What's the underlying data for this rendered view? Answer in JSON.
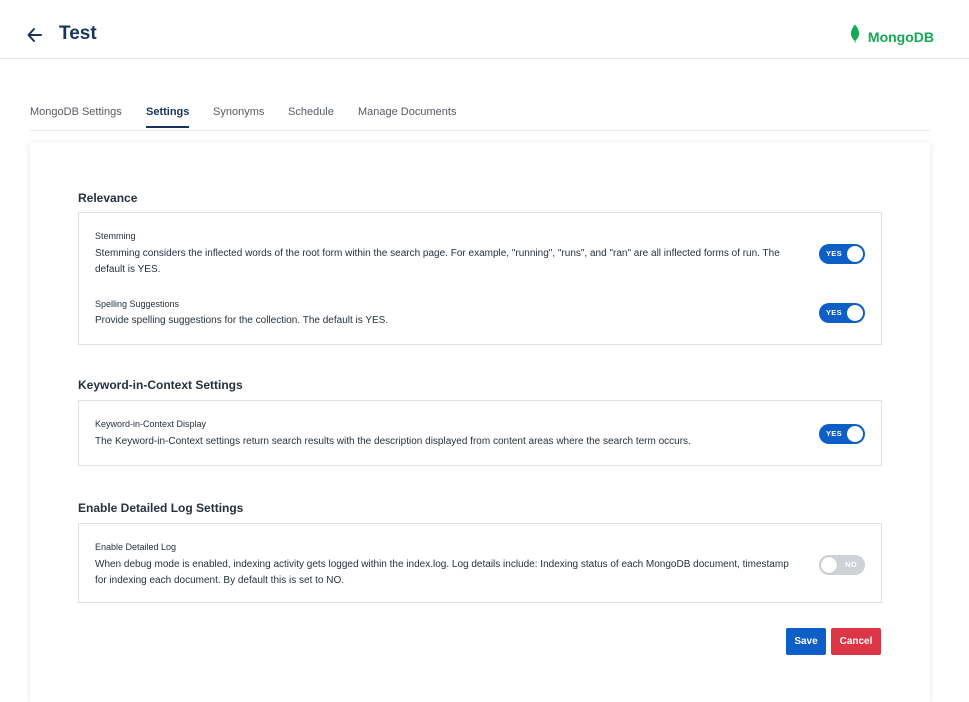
{
  "header": {
    "title": "Test",
    "brand_label": "MongoDB",
    "brand_color": "#13aa52"
  },
  "tabs": [
    {
      "label": "MongoDB Settings",
      "active": false
    },
    {
      "label": "Settings",
      "active": true
    },
    {
      "label": "Synonyms",
      "active": false
    },
    {
      "label": "Schedule",
      "active": false
    },
    {
      "label": "Manage Documents",
      "active": false
    }
  ],
  "sections": {
    "relevance": {
      "title": "Relevance",
      "settings": [
        {
          "name": "Stemming",
          "description": "Stemming considers the inflected words of the root form within the search page. For example, \"running\", \"runs\", and \"ran\" are all inflected forms of run. The default is YES.",
          "toggle": "YES",
          "enabled": true
        },
        {
          "name": "Spelling Suggestions",
          "description": "Provide spelling suggestions for the collection. The default is YES.",
          "toggle": "YES",
          "enabled": true
        }
      ]
    },
    "kwic": {
      "title": "Keyword-in-Context Settings",
      "settings": [
        {
          "name": "Keyword-in-Context Display",
          "description": "The Keyword-in-Context settings return search results with the description displayed from content areas where the search term occurs.",
          "toggle": "YES",
          "enabled": true
        }
      ]
    },
    "log": {
      "title": "Enable Detailed Log Settings",
      "settings": [
        {
          "name": "Enable Detailed Log",
          "description": "When debug mode is enabled, indexing activity gets logged within the index.log. Log details include: Indexing status of each MongoDB document, timestamp for indexing each document. By default this is set to NO.",
          "toggle": "NO",
          "enabled": false
        }
      ]
    }
  },
  "actions": {
    "save_label": "Save",
    "cancel_label": "Cancel"
  },
  "colors": {
    "primary": "#0d5ec6",
    "danger": "#dc3545",
    "title": "#18345c"
  },
  "icons": {
    "back": "arrow-left-icon",
    "brand": "mongodb-leaf-icon"
  }
}
